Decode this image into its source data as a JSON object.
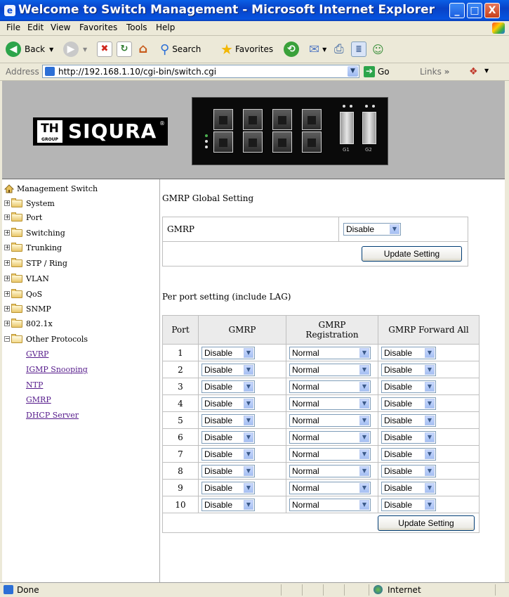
{
  "window": {
    "title": "Welcome to Switch Management - Microsoft Internet Explorer",
    "minimize": "_",
    "maximize": "□",
    "close": "X"
  },
  "menu": [
    "File",
    "Edit",
    "View",
    "Favorites",
    "Tools",
    "Help"
  ],
  "toolbar": {
    "back": "Back",
    "search": "Search",
    "favorites": "Favorites"
  },
  "address": {
    "label": "Address",
    "url": "http://192.168.1.10/cgi-bin/switch.cgi",
    "go": "Go",
    "links": "Links"
  },
  "banner": {
    "brand_th": "TH",
    "brand_group": "GROUP",
    "brand_name": "SIQURA",
    "brand_reg": "®",
    "sfp_labels": [
      "G1",
      "G2"
    ]
  },
  "sidebar": {
    "root": "Management Switch",
    "items": [
      {
        "label": "System"
      },
      {
        "label": "Port"
      },
      {
        "label": "Switching"
      },
      {
        "label": "Trunking"
      },
      {
        "label": "STP / Ring"
      },
      {
        "label": "VLAN"
      },
      {
        "label": "QoS"
      },
      {
        "label": "SNMP"
      },
      {
        "label": "802.1x"
      },
      {
        "label": "Other Protocols"
      }
    ],
    "children": [
      "GVRP",
      "IGMP Snooping",
      "NTP",
      "GMRP",
      "DHCP Server"
    ]
  },
  "global": {
    "title": "GMRP Global Setting",
    "label": "GMRP",
    "value": "Disable",
    "button": "Update Setting"
  },
  "perport": {
    "title": "Per port setting (include LAG)",
    "headers": {
      "port": "Port",
      "gmrp": "GMRP",
      "registration_line1": "GMRP",
      "registration_line2": "Registration",
      "forward": "GMRP Forward All"
    },
    "rows": [
      {
        "port": "1",
        "gmrp": "Disable",
        "registration": "Normal",
        "forward": "Disable"
      },
      {
        "port": "2",
        "gmrp": "Disable",
        "registration": "Normal",
        "forward": "Disable"
      },
      {
        "port": "3",
        "gmrp": "Disable",
        "registration": "Normal",
        "forward": "Disable"
      },
      {
        "port": "4",
        "gmrp": "Disable",
        "registration": "Normal",
        "forward": "Disable"
      },
      {
        "port": "5",
        "gmrp": "Disable",
        "registration": "Normal",
        "forward": "Disable"
      },
      {
        "port": "6",
        "gmrp": "Disable",
        "registration": "Normal",
        "forward": "Disable"
      },
      {
        "port": "7",
        "gmrp": "Disable",
        "registration": "Normal",
        "forward": "Disable"
      },
      {
        "port": "8",
        "gmrp": "Disable",
        "registration": "Normal",
        "forward": "Disable"
      },
      {
        "port": "9",
        "gmrp": "Disable",
        "registration": "Normal",
        "forward": "Disable"
      },
      {
        "port": "10",
        "gmrp": "Disable",
        "registration": "Normal",
        "forward": "Disable"
      }
    ],
    "button": "Update Setting"
  },
  "status": {
    "text": "Done",
    "zone": "Internet"
  }
}
